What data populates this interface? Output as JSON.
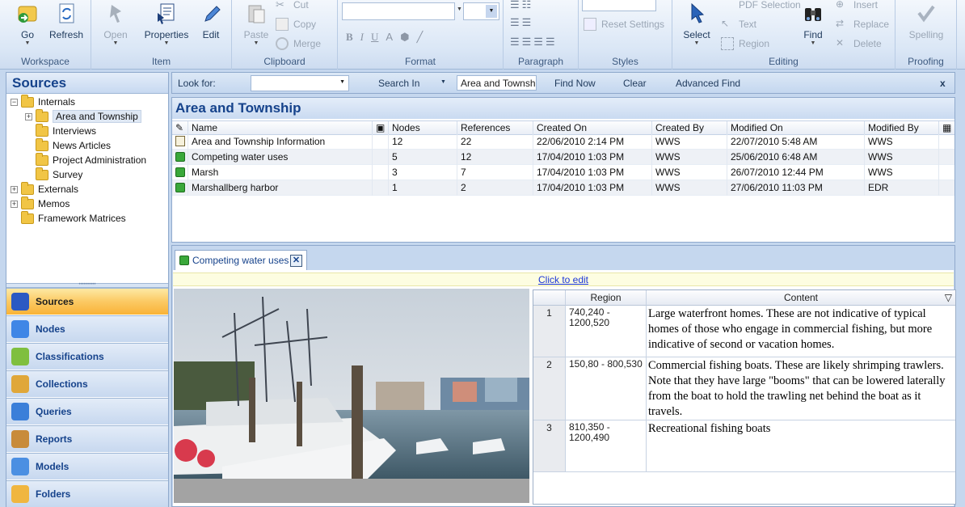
{
  "ribbon": {
    "groups": {
      "workspace": "Workspace",
      "item": "Item",
      "clipboard": "Clipboard",
      "format": "Format",
      "paragraph": "Paragraph",
      "styles": "Styles",
      "editing": "Editing",
      "proofing": "Proofing"
    },
    "buttons": {
      "go": "Go",
      "refresh": "Refresh",
      "open": "Open",
      "properties": "Properties",
      "edit": "Edit",
      "paste": "Paste",
      "cut": "Cut",
      "copy": "Copy",
      "merge": "Merge",
      "reset_settings": "Reset Settings",
      "select": "Select",
      "pdf_selection": "PDF Selection",
      "text": "Text",
      "region": "Region",
      "find": "Find",
      "insert": "Insert",
      "replace": "Replace",
      "delete": "Delete",
      "spelling": "Spelling"
    },
    "format": {
      "bold": "B",
      "italic": "I",
      "underline": "U",
      "grow_font": "A"
    }
  },
  "sources_panel": {
    "title": "Sources",
    "tree": [
      {
        "label": "Internals",
        "level": 0,
        "expander": "−"
      },
      {
        "label": "Area and Township",
        "level": 1,
        "expander": "+",
        "selected": true
      },
      {
        "label": "Interviews",
        "level": 1
      },
      {
        "label": "News Articles",
        "level": 1
      },
      {
        "label": "Project Administration",
        "level": 1
      },
      {
        "label": "Survey",
        "level": 1
      },
      {
        "label": "Externals",
        "level": 0,
        "expander": "+"
      },
      {
        "label": "Memos",
        "level": 0,
        "expander": "+"
      },
      {
        "label": "Framework Matrices",
        "level": 0
      }
    ]
  },
  "navigation": [
    {
      "label": "Sources",
      "icon": "sources-icon",
      "active": true
    },
    {
      "label": "Nodes",
      "icon": "nodes-icon"
    },
    {
      "label": "Classifications",
      "icon": "classifications-icon"
    },
    {
      "label": "Collections",
      "icon": "collections-icon"
    },
    {
      "label": "Queries",
      "icon": "queries-icon"
    },
    {
      "label": "Reports",
      "icon": "reports-icon"
    },
    {
      "label": "Models",
      "icon": "models-icon"
    },
    {
      "label": "Folders",
      "icon": "folders-icon"
    }
  ],
  "find_bar": {
    "look_for_label": "Look for:",
    "look_for_value": "",
    "search_in_label": "Search In",
    "search_in_value": "Area and Townsh",
    "find_now": "Find Now",
    "clear": "Clear",
    "advanced_find": "Advanced Find",
    "close": "x"
  },
  "list_view": {
    "title": "Area and Township",
    "columns": [
      "Name",
      "Nodes",
      "References",
      "Created On",
      "Created By",
      "Modified On",
      "Modified By"
    ],
    "rows": [
      {
        "icon": "document-icon",
        "name": "Area and Township Information",
        "nodes": "12",
        "references": "22",
        "created_on": "22/06/2010 2:14 PM",
        "created_by": "WWS",
        "modified_on": "22/07/2010 5:48 AM",
        "modified_by": "WWS"
      },
      {
        "icon": "picture-icon",
        "name": "Competing water uses",
        "nodes": "5",
        "references": "12",
        "created_on": "17/04/2010 1:03 PM",
        "created_by": "WWS",
        "modified_on": "25/06/2010 6:48 AM",
        "modified_by": "WWS"
      },
      {
        "icon": "picture-icon",
        "name": "Marsh",
        "nodes": "3",
        "references": "7",
        "created_on": "17/04/2010 1:03 PM",
        "created_by": "WWS",
        "modified_on": "26/07/2010 12:44 PM",
        "modified_by": "WWS"
      },
      {
        "icon": "picture-icon",
        "name": "Marshallberg harbor",
        "nodes": "1",
        "references": "2",
        "created_on": "17/04/2010 1:03 PM",
        "created_by": "WWS",
        "modified_on": "27/06/2010 11:03 PM",
        "modified_by": "EDR"
      }
    ]
  },
  "detail": {
    "tab_label": "Competing water uses",
    "click_to_edit": "Click to edit",
    "region_columns": [
      "Region",
      "Content"
    ],
    "regions": [
      {
        "num": "1",
        "region": "740,240 - 1200,520",
        "content": "Large waterfront homes. These are not indicative of typical homes of those who engage in commercial fishing, but more indicative of second or vacation homes."
      },
      {
        "num": "2",
        "region": "150,80 - 800,530",
        "content": "Commercial fishing boats. These are likely shrimping trawlers. Note that they have large \"booms\" that can be lowered laterally from the boat to hold the trawling net behind the boat as it travels."
      },
      {
        "num": "3",
        "region": "810,350 - 1200,490",
        "content": "Recreational fishing boats"
      }
    ]
  },
  "colors": {
    "accent": "#15428b",
    "active_nav": "#f9b337",
    "ribbon_bg": "#dbe7f6"
  }
}
